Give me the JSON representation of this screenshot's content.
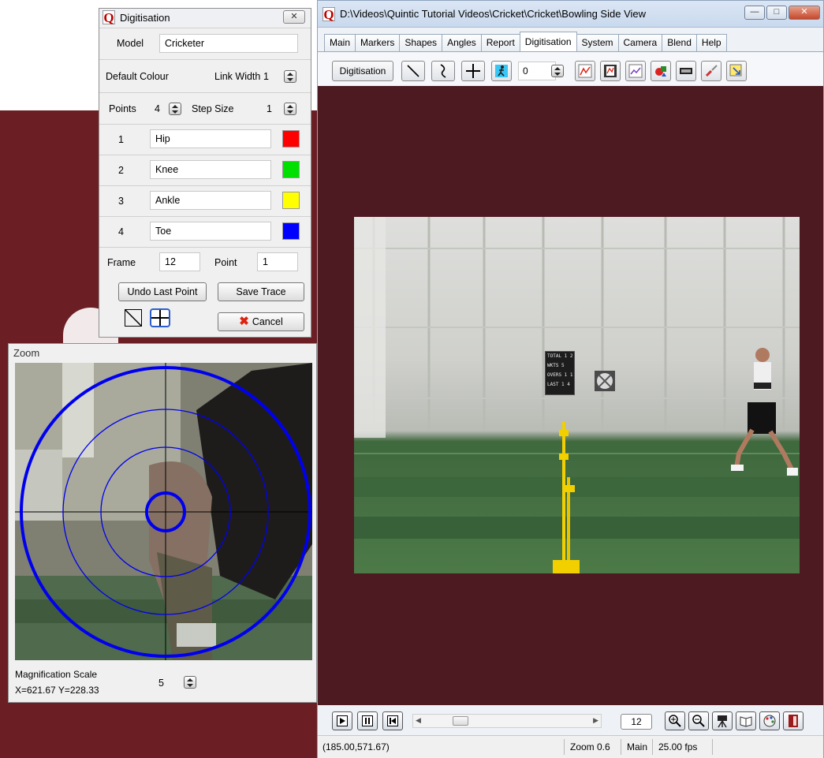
{
  "digitisation": {
    "title": "Digitisation",
    "close_icon": "x-icon",
    "model_label": "Model",
    "model_value": "Cricketer",
    "default_colour_label": "Default Colour",
    "link_width_label": "Link Width",
    "link_width_value": "1",
    "points_label": "Points",
    "points_value": "4",
    "step_size_label": "Step Size",
    "step_size_value": "1",
    "points": [
      {
        "num": "1",
        "name": "Hip",
        "color": "#ff0000"
      },
      {
        "num": "2",
        "name": "Knee",
        "color": "#00e000"
      },
      {
        "num": "3",
        "name": "Ankle",
        "color": "#ffff00"
      },
      {
        "num": "4",
        "name": "Toe",
        "color": "#0000ff"
      }
    ],
    "frame_label": "Frame",
    "frame_value": "12",
    "point_label": "Point",
    "point_value": "1",
    "undo_label": "Undo Last Point",
    "save_trace_label": "Save Trace",
    "cancel_label": "Cancel"
  },
  "zoom": {
    "title": "Zoom",
    "magnification_label": "Magnification Scale",
    "magnification_value": "5",
    "coords": "X=621.67    Y=228.33"
  },
  "main_window": {
    "title": "D:\\Videos\\Quintic Tutorial Videos\\Cricket\\Cricket\\Bowling Side View",
    "tabs": [
      "Main",
      "Markers",
      "Shapes",
      "Angles",
      "Report",
      "Digitisation",
      "System",
      "Camera",
      "Blend",
      "Help"
    ],
    "active_tab": "Digitisation",
    "toolbar": {
      "digitisation_button": "Digitisation",
      "counter_value": "0"
    },
    "video": {
      "scoreboard_lines": [
        "TOTAL 1 2",
        "WKTS  5",
        "OVERS 1 1",
        "LAST 1 4"
      ]
    },
    "controls": {
      "frame_value": "12"
    },
    "status": {
      "coords": "(185.00,571.67)",
      "zoom": "Zoom  0.6",
      "mode": "Main",
      "fps": "25.00 fps"
    }
  },
  "colors": {
    "brand_maroon": "#6b1f24",
    "viewer_background": "#4d1a22",
    "reticle_blue": "#0000ee"
  }
}
